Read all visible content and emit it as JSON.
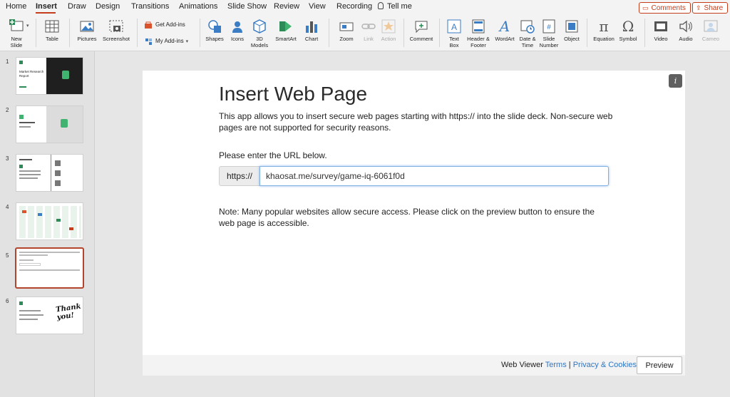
{
  "menu": {
    "tabs": [
      "Home",
      "Insert",
      "Draw",
      "Design",
      "Transitions",
      "Animations",
      "Slide Show",
      "Review",
      "View",
      "Recording"
    ],
    "active_tab": "Insert",
    "tell_me": "Tell me",
    "comments_label": "Comments",
    "share_label": "Share",
    "accent_color": "#c43e1c"
  },
  "ribbon": {
    "new_slide": "New\nSlide",
    "table": "Table",
    "pictures": "Pictures",
    "screenshot": "Screenshot",
    "get_addins": "Get Add-ins",
    "my_addins": "My Add-ins",
    "shapes": "Shapes",
    "icons": "Icons",
    "models3d": "3D\nModels",
    "smartart": "SmartArt",
    "chart": "Chart",
    "zoom": "Zoom",
    "link": "Link",
    "action": "Action",
    "comment": "Comment",
    "text_box": "Text\nBox",
    "header_footer": "Header &\nFooter",
    "wordart": "WordArt",
    "date_time": "Date &\nTime",
    "slide_number": "Slide\nNumber",
    "object": "Object",
    "equation": "Equation",
    "symbol": "Symbol",
    "video": "Video",
    "audio": "Audio",
    "cameo": "Cameo"
  },
  "thumbnails": {
    "numbers": [
      "1",
      "2",
      "3",
      "4",
      "5",
      "6"
    ],
    "selected": 5,
    "t1_title": "Market Research\nReport",
    "t6_text": "Thank\nyou!"
  },
  "addin": {
    "title": "Insert Web Page",
    "description": "This app allows you to insert secure web pages starting with https:// into the slide deck. Non-secure web pages are not supported for security reasons.",
    "prompt": "Please enter the URL below.",
    "url_prefix": "https://",
    "url_value": "khaosat.me/survey/game-iq-6061f0d",
    "note": "Note: Many popular websites allow secure access. Please click on the preview button to ensure the web page is accessible.",
    "info_label": "i",
    "footer_label": "Web Viewer",
    "terms_link": "Terms",
    "footer_sep": "|",
    "privacy_link": "Privacy & Cookies",
    "preview_button": "Preview"
  }
}
